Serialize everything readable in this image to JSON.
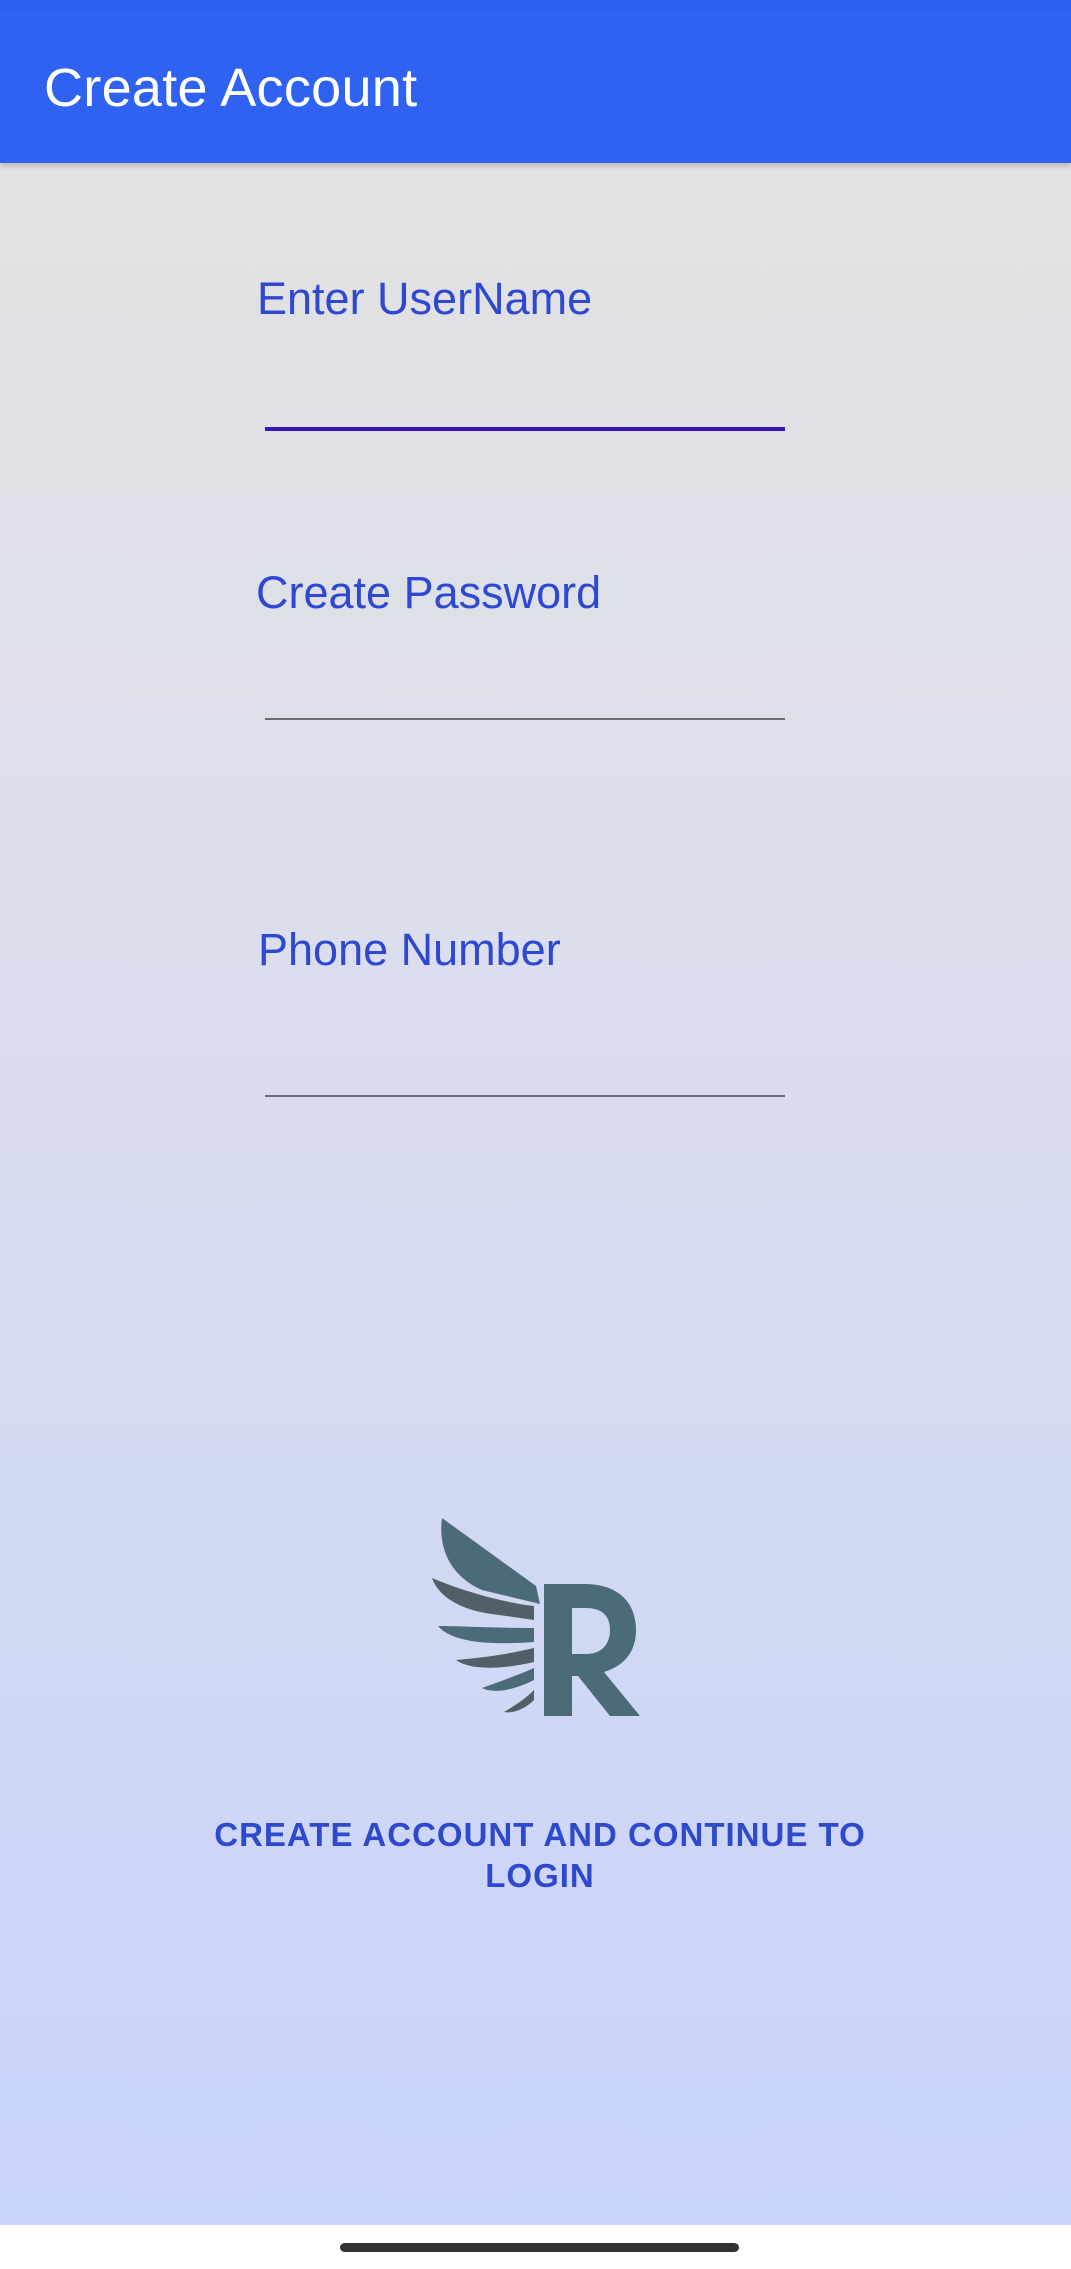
{
  "app_bar": {
    "title": "Create Account"
  },
  "form": {
    "username": {
      "label": "Enter UserName",
      "value": ""
    },
    "password": {
      "label": "Create Password",
      "value": ""
    },
    "phone": {
      "label": "Phone Number",
      "value": ""
    }
  },
  "logo": {
    "letter": "R",
    "icon": "winged-r-logo"
  },
  "actions": {
    "submit_label": "CREATE ACCOUNT AND CONTINUE TO LOGIN"
  },
  "colors": {
    "app_bar": "#3062f2",
    "label_text": "#2e49d0",
    "focused_underline": "#3a16b0",
    "logo": "#4a6b77"
  }
}
